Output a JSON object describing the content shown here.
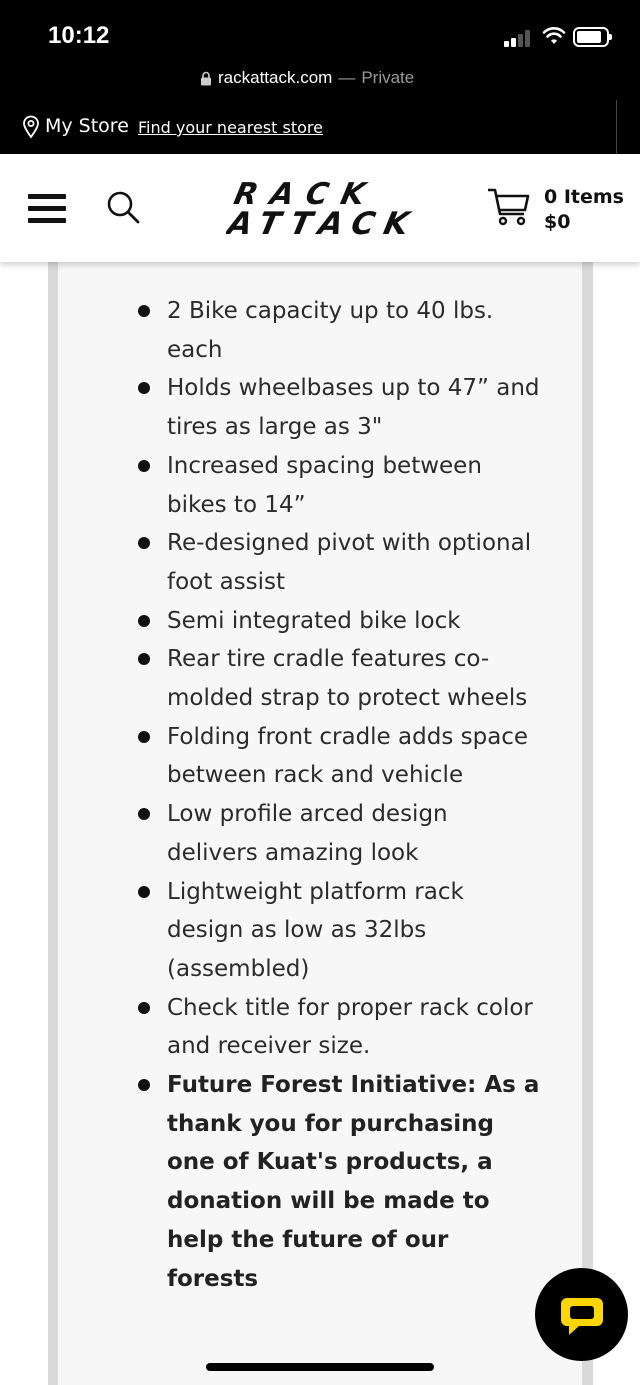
{
  "status_bar": {
    "time": "10:12"
  },
  "url_bar": {
    "domain": "rackattack.com",
    "separator": "—",
    "mode": "Private"
  },
  "store_bar": {
    "label": "My Store",
    "link": "Find your nearest store"
  },
  "header": {
    "logo_text": [
      "RACK",
      "ATTACK"
    ],
    "cart_items": "0 Items",
    "cart_total": "$0"
  },
  "features": [
    {
      "text": "2 Bike capacity up to 40 lbs. each",
      "bold": false
    },
    {
      "text": "Holds wheelbases up to 47” and tires as large as 3\"",
      "bold": false
    },
    {
      "text": "Increased spacing between bikes to 14”",
      "bold": false
    },
    {
      "text": "Re-designed pivot with optional foot assist",
      "bold": false
    },
    {
      "text": "Semi integrated bike lock",
      "bold": false
    },
    {
      "text": "Rear tire cradle features co-molded strap to protect wheels",
      "bold": false
    },
    {
      "text": "Folding front cradle adds space between rack and vehicle",
      "bold": false
    },
    {
      "text": "Low profile arced design delivers amazing look",
      "bold": false
    },
    {
      "text": "Lightweight platform rack design as low as 32lbs (assembled)",
      "bold": false
    },
    {
      "text": "Check title for proper rack color and receiver size.",
      "bold": false
    },
    {
      "text": "Future Forest Initiative: As a thank you for purchasing one of Kuat's products, a donation will be made to help the future of our forests",
      "bold": true
    }
  ],
  "colors": {
    "accent": "#ffd500",
    "header_bg": "#000000",
    "panel_bg": "#f7f7f7"
  },
  "icons": [
    "lock-icon",
    "pin-icon",
    "menu-icon",
    "search-icon",
    "cart-icon",
    "chat-icon"
  ]
}
